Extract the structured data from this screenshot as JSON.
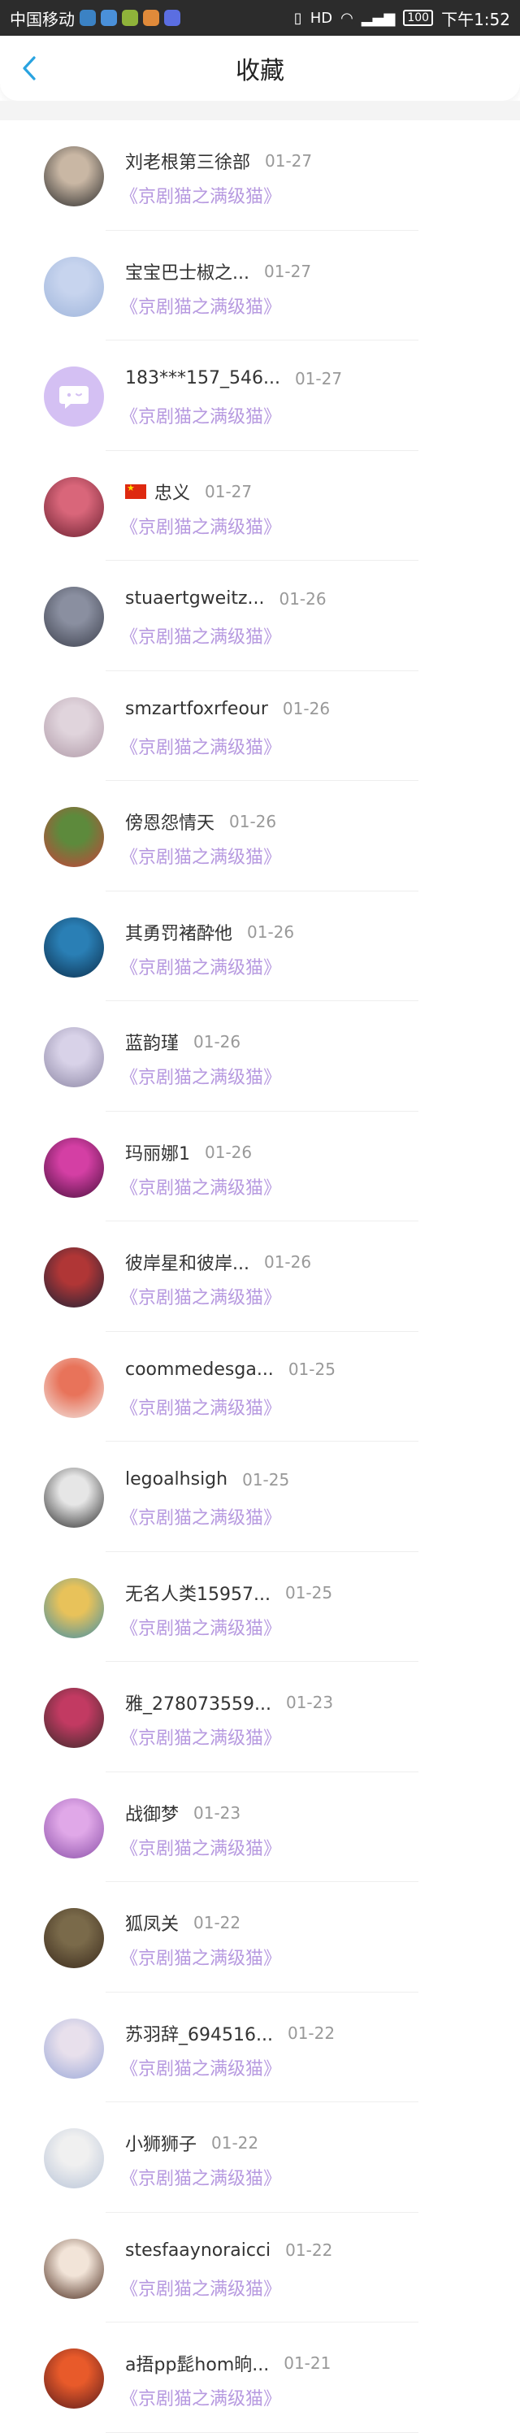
{
  "status_bar": {
    "carrier": "中国移动",
    "right_text": "HD",
    "battery": "100",
    "time": "下午1:52",
    "app_icon_colors": [
      "#3b82c4",
      "#4a90d9",
      "#8fb33a",
      "#e08a3a",
      "#5b6ee1"
    ]
  },
  "header": {
    "title": "收藏",
    "back_icon": "chevron-left-icon",
    "accent_color": "#29a3e0"
  },
  "favorites": [
    {
      "name": "刘老根第三徐部",
      "date": "01-27",
      "title": "《京剧猫之满级猫》",
      "avatar": "photo",
      "avatar_colors": [
        "#c9b7a4",
        "#2b2b2b"
      ]
    },
    {
      "name": "宝宝巴士椒之...",
      "date": "01-27",
      "title": "《京剧猫之满级猫》",
      "avatar": "photo",
      "avatar_colors": [
        "#c7d4ee",
        "#9fb5db"
      ]
    },
    {
      "name": "183***157_546...",
      "date": "01-27",
      "title": "《京剧猫之满级猫》",
      "avatar": "chat-bubble-icon",
      "avatar_colors": [
        "#d4c0f3",
        "#ffffff"
      ]
    },
    {
      "name": "忠义",
      "date": "01-27",
      "title": "《京剧猫之满级猫》",
      "avatar": "photo",
      "avatar_colors": [
        "#d9667a",
        "#6b2030"
      ],
      "flag": true
    },
    {
      "name": "stuaertgweitz...",
      "date": "01-26",
      "title": "《京剧猫之满级猫》",
      "avatar": "photo",
      "avatar_colors": [
        "#8a8fa0",
        "#3b3f4c"
      ]
    },
    {
      "name": "smzartfoxrfeour",
      "date": "01-26",
      "title": "《京剧猫之满级猫》",
      "avatar": "photo",
      "avatar_colors": [
        "#e0d4dc",
        "#b09aa8"
      ]
    },
    {
      "name": "傍恩怨情天",
      "date": "01-26",
      "title": "《京剧猫之满级猫》",
      "avatar": "photo",
      "avatar_colors": [
        "#5d8a3c",
        "#c8413a"
      ]
    },
    {
      "name": "其勇罚褚酔他",
      "date": "01-26",
      "title": "《京剧猫之满级猫》",
      "avatar": "photo",
      "avatar_colors": [
        "#2a7fb5",
        "#0b2e4c"
      ]
    },
    {
      "name": "蓝韵瑾",
      "date": "01-26",
      "title": "《京剧猫之满级猫》",
      "avatar": "photo",
      "avatar_colors": [
        "#d8d2e8",
        "#8c86a4"
      ]
    },
    {
      "name": "玛丽娜1",
      "date": "01-26",
      "title": "《京剧猫之满级猫》",
      "avatar": "photo",
      "avatar_colors": [
        "#d43fa4",
        "#4a0f3d"
      ]
    },
    {
      "name": "彼岸星和彼岸...",
      "date": "01-26",
      "title": "《京剧猫之满级猫》",
      "avatar": "photo",
      "avatar_colors": [
        "#b03636",
        "#1c2236"
      ]
    },
    {
      "name": "coommedesga...",
      "date": "01-25",
      "title": "《京剧猫之满级猫》",
      "avatar": "photo",
      "avatar_colors": [
        "#e8735a",
        "#f2e8e4"
      ]
    },
    {
      "name": "legoalhsigh",
      "date": "01-25",
      "title": "《京剧猫之满级猫》",
      "avatar": "photo",
      "avatar_colors": [
        "#e6e6e6",
        "#2b2b2b"
      ]
    },
    {
      "name": "无名人类15957...",
      "date": "01-25",
      "title": "《京剧猫之满级猫》",
      "avatar": "photo",
      "avatar_colors": [
        "#e8c25a",
        "#3f8fa8"
      ]
    },
    {
      "name": "雅_278073559...",
      "date": "01-23",
      "title": "《京剧猫之满级猫》",
      "avatar": "photo",
      "avatar_colors": [
        "#c23a62",
        "#3b2a2a"
      ]
    },
    {
      "name": "战御梦",
      "date": "01-23",
      "title": "《京剧猫之满级猫》",
      "avatar": "photo",
      "avatar_colors": [
        "#e0a8e8",
        "#8a4fa8"
      ]
    },
    {
      "name": "狐凤关",
      "date": "01-22",
      "title": "《京剧猫之满级猫》",
      "avatar": "photo",
      "avatar_colors": [
        "#7a6a4a",
        "#3a2a1c"
      ]
    },
    {
      "name": "苏羽辞_694516...",
      "date": "01-22",
      "title": "《京剧猫之满级猫》",
      "avatar": "photo",
      "avatar_colors": [
        "#e8e0ec",
        "#9aa8d8"
      ]
    },
    {
      "name": "小狮狮子",
      "date": "01-22",
      "title": "《京剧猫之满级猫》",
      "avatar": "photo",
      "avatar_colors": [
        "#f0f0f0",
        "#b8c4d8"
      ]
    },
    {
      "name": "stesfaaynoraicci",
      "date": "01-22",
      "title": "《京剧猫之满级猫》",
      "avatar": "photo",
      "avatar_colors": [
        "#f2e4d8",
        "#4a2a1c"
      ]
    },
    {
      "name": "a捂pp髭hom晌...",
      "date": "01-21",
      "title": "《京剧猫之满级猫》",
      "avatar": "photo",
      "avatar_colors": [
        "#e85a2a",
        "#5a1c1c"
      ]
    }
  ]
}
